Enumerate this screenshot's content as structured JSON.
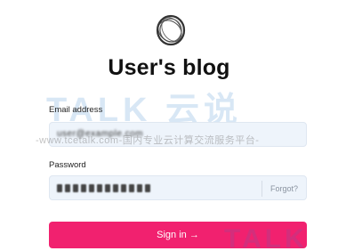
{
  "app": {
    "title": "User's blog",
    "logo_icon": "ring-logo-icon"
  },
  "form": {
    "email": {
      "label": "Email address",
      "value": "user@example.com"
    },
    "password": {
      "label": "Password",
      "masked_length": 12,
      "forgot_label": "Forgot?"
    },
    "submit": {
      "label": "Sign in →",
      "color": "#f1216f"
    }
  },
  "watermark": {
    "main": "TALK 云说",
    "sub": "-www.tcetalk.com-国内专业云计算交流服务平台-",
    "corner": "TALK"
  },
  "colors": {
    "field_bg": "#eef4fb",
    "accent": "#f1216f",
    "text": "#111111"
  }
}
